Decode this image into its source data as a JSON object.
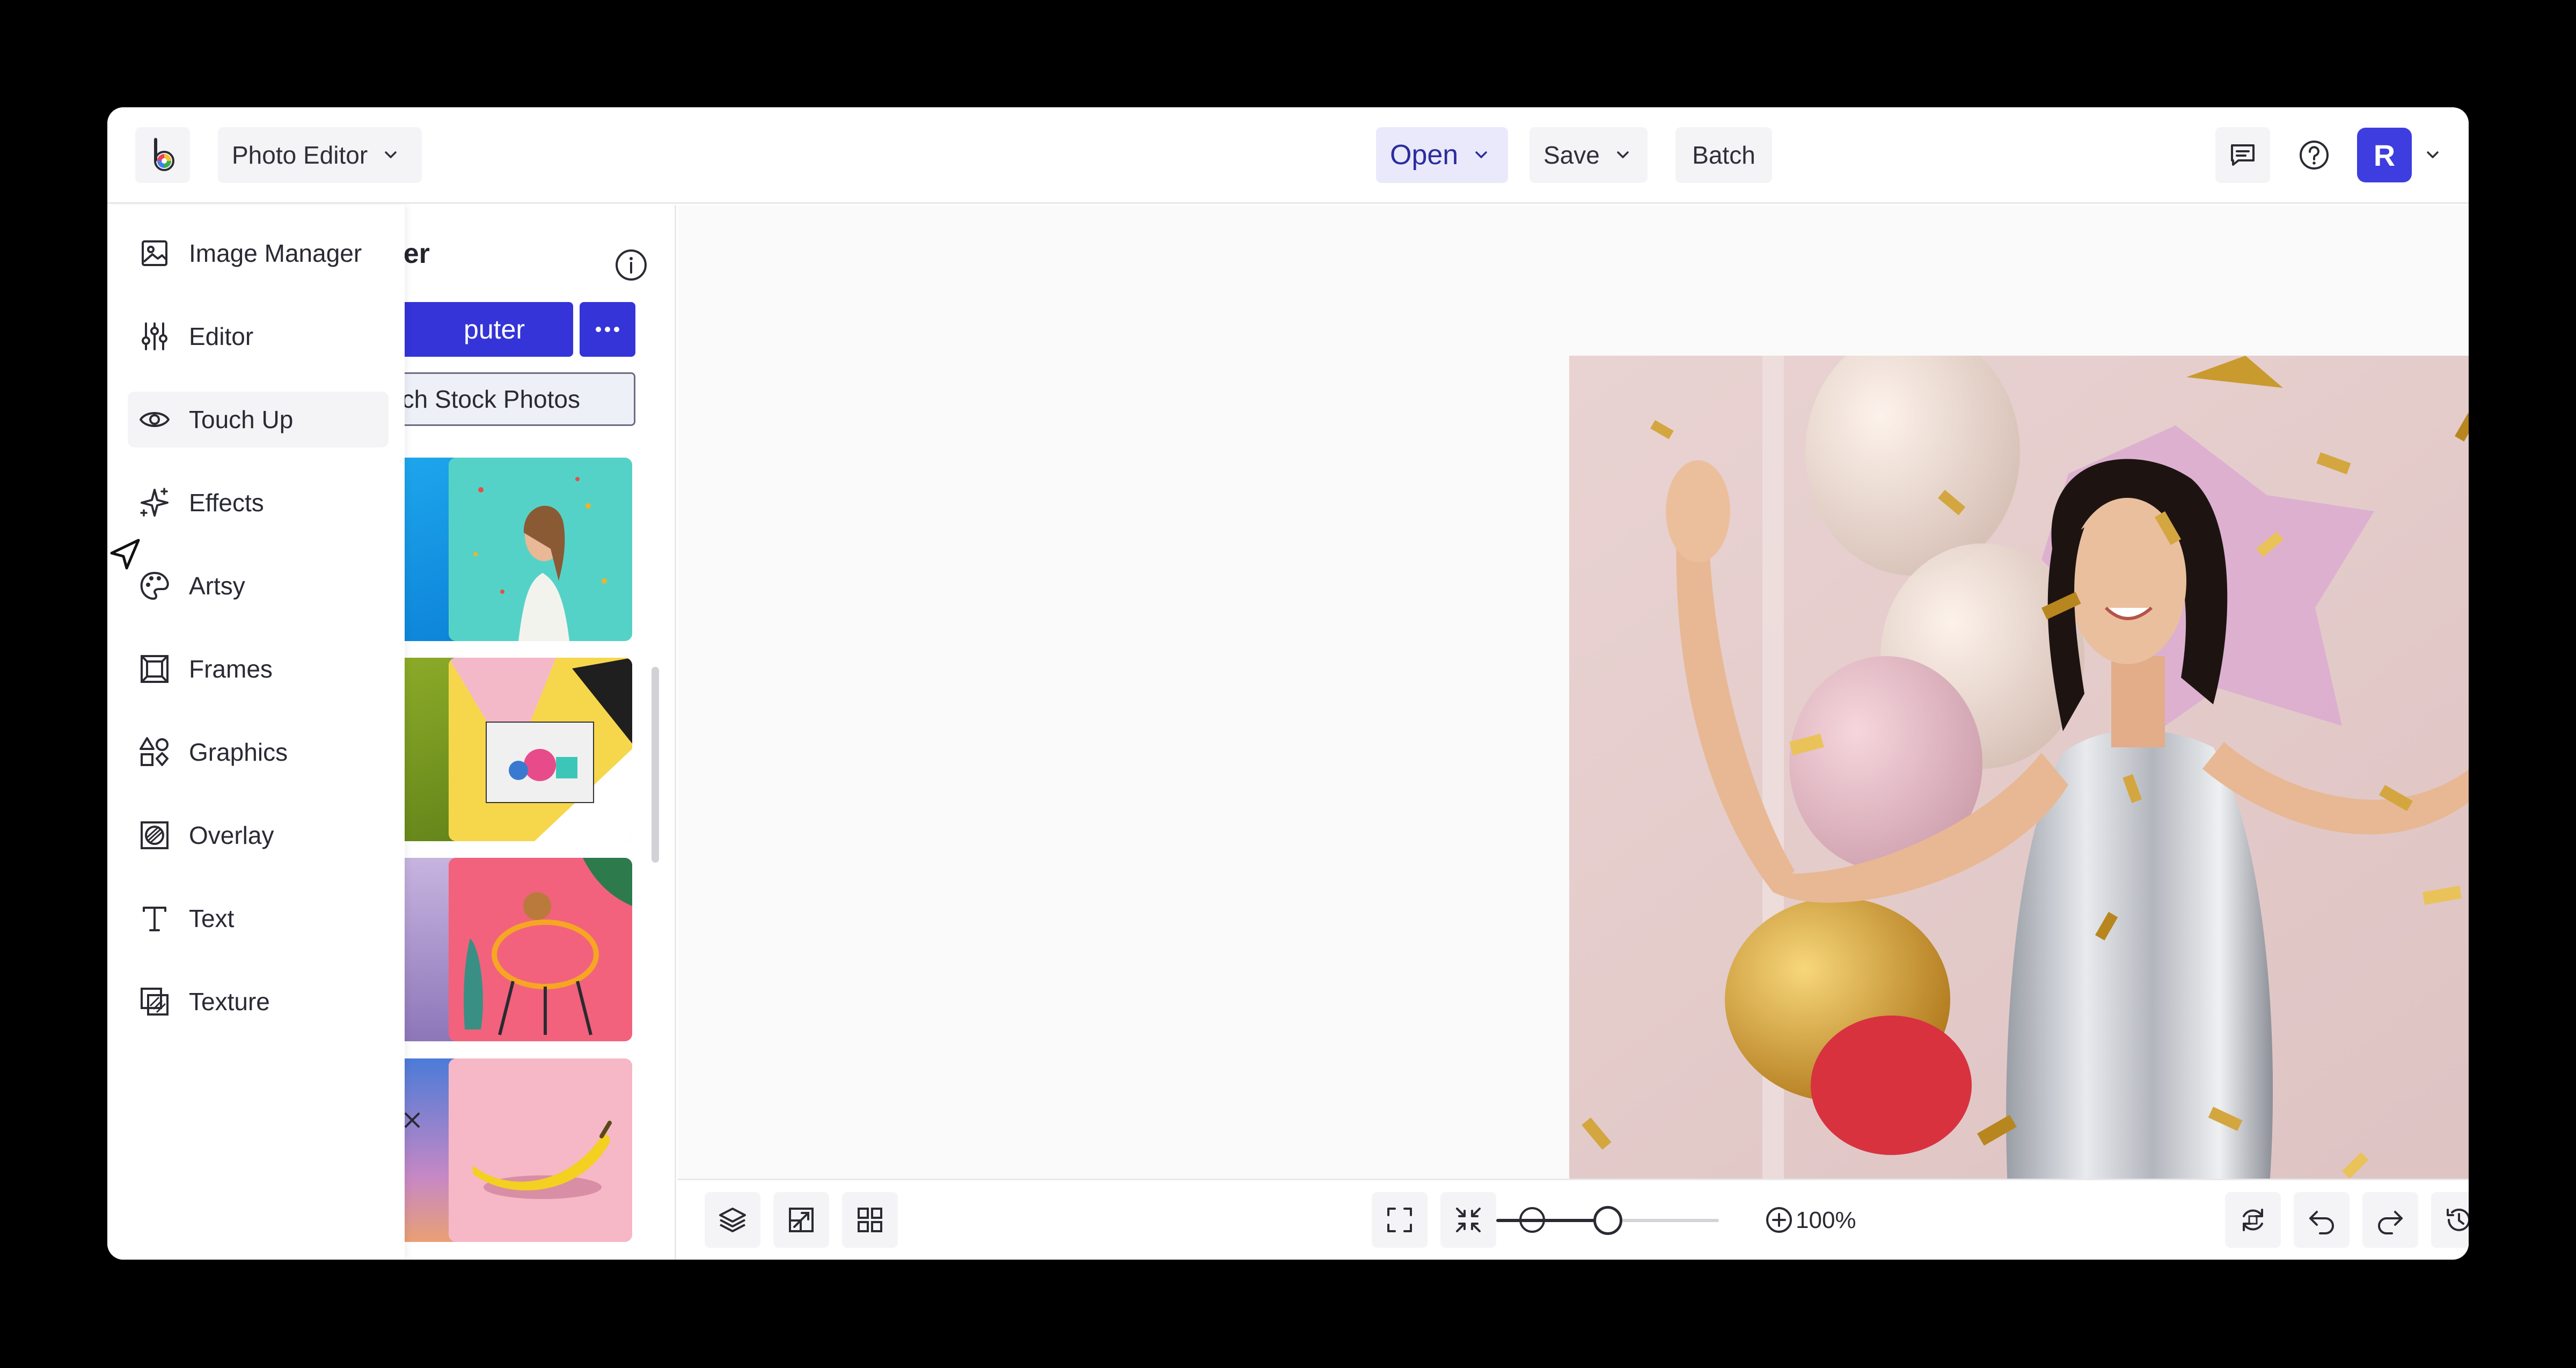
{
  "topbar": {
    "app_switcher": "Photo Editor",
    "open": "Open",
    "save": "Save",
    "batch": "Batch",
    "avatar_initial": "R"
  },
  "panel": {
    "title_visible": "ger",
    "computer_visible": "puter",
    "stock_visible": "ch Stock Photos"
  },
  "nav": {
    "active": "Touch Up",
    "items": [
      {
        "label": "Image Manager",
        "icon": "image-icon"
      },
      {
        "label": "Editor",
        "icon": "sliders-icon"
      },
      {
        "label": "Touch Up",
        "icon": "eye-icon"
      },
      {
        "label": "Effects",
        "icon": "sparkles-icon"
      },
      {
        "label": "Artsy",
        "icon": "palette-icon"
      },
      {
        "label": "Frames",
        "icon": "frame-icon"
      },
      {
        "label": "Graphics",
        "icon": "shapes-icon"
      },
      {
        "label": "Overlay",
        "icon": "overlay-icon"
      },
      {
        "label": "Text",
        "icon": "text-icon"
      },
      {
        "label": "Texture",
        "icon": "texture-icon"
      }
    ]
  },
  "zoom": {
    "value": "100%",
    "level": 0.5
  },
  "colors": {
    "accent": "#3434d8",
    "open_bg": "#e9e9fb",
    "canvas_bg": "#fafafa"
  }
}
